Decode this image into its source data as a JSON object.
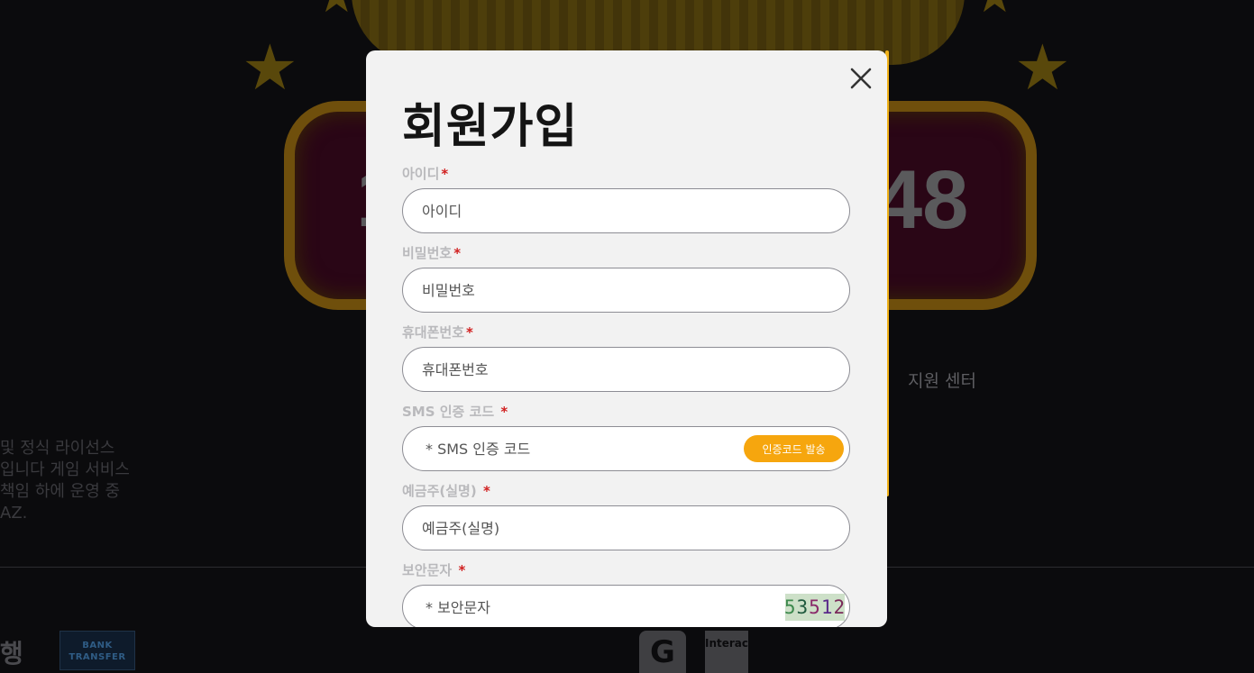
{
  "background": {
    "counter_left_digit": "1",
    "counter_right_digits": "48",
    "support_link": "지원 센터",
    "license_text": "\n및 정식 라이선스\n입니다 게임 서비스\n책임 하에 운영 중\nAZ.",
    "logos": {
      "hang": "행",
      "transfer": "BANK\nTRANSFER",
      "g": "G",
      "interac": "Interac"
    },
    "colors": {
      "page_bg": "#0b0b0d",
      "banner_frame": "#6f4f0c",
      "banner_fill": "#2a0616"
    }
  },
  "modal": {
    "title": "회원가입",
    "close_icon": "close-icon",
    "accent_color": "#f0b21a",
    "fields": [
      {
        "label": "아이디",
        "required_mark": "*",
        "placeholder": "아이디"
      },
      {
        "label": "비밀번호",
        "required_mark": "*",
        "placeholder": "비밀번호"
      },
      {
        "label": "휴대폰번호",
        "required_mark": "*",
        "placeholder": "휴대폰번호"
      },
      {
        "label": "SMS 인증 코드 ",
        "required_mark": "*",
        "placeholder": "* SMS 인증 코드",
        "button": "인증코드 발송"
      },
      {
        "label": "예금주(실명) ",
        "required_mark": "*",
        "placeholder": "예금주(실명)"
      },
      {
        "label": "보안문자 ",
        "required_mark": "*",
        "placeholder": "* 보안문자",
        "captcha": [
          "5",
          "3",
          "5",
          "1",
          "2"
        ]
      }
    ],
    "colors": {
      "button": "#f6a60e",
      "required": "#d12020",
      "label": "#b9b9bc"
    }
  }
}
